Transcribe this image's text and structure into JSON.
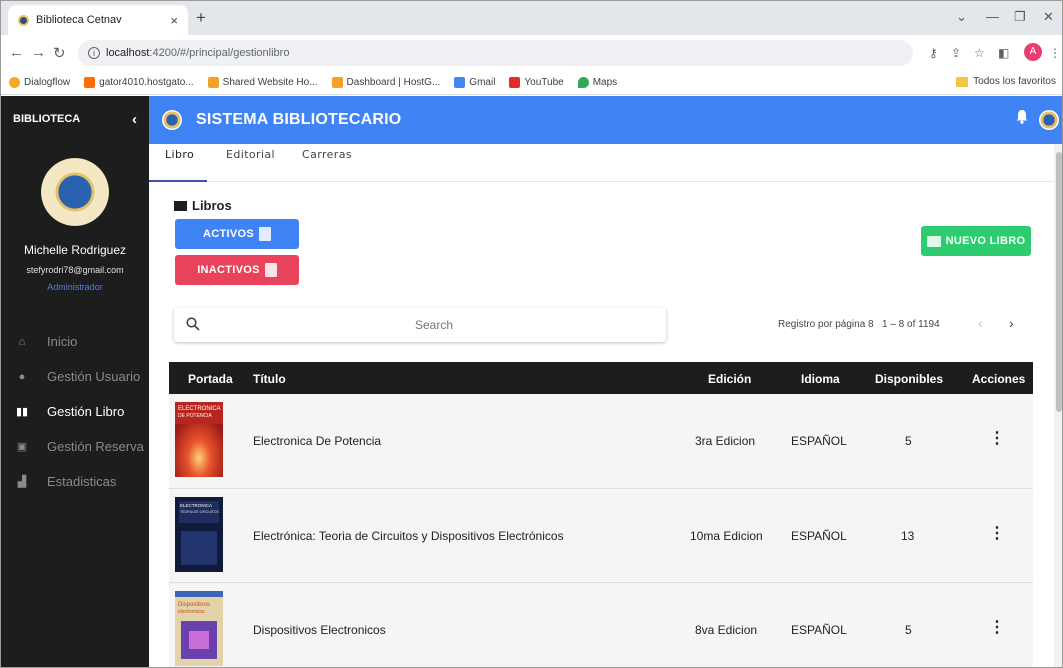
{
  "browser": {
    "tab_title": "Biblioteca Cetnav",
    "new_tab": "+",
    "url_host": "localhost",
    "url_path": ":4200/#/principal/gestionlibro",
    "bookmarks": [
      {
        "label": "Dialogflow",
        "color": "#f9a825"
      },
      {
        "label": "gator4010.hostgato...",
        "color": "#ff6d00"
      },
      {
        "label": "Shared Website Ho...",
        "color": "#f4a12b"
      },
      {
        "label": "Dashboard | HostG...",
        "color": "#f4a12b"
      },
      {
        "label": "Gmail",
        "color": "#4285f4"
      },
      {
        "label": "YouTube",
        "color": "#e52d27"
      },
      {
        "label": "Maps",
        "color": "#34a853"
      }
    ],
    "favorites_label": "Todos los favoritos",
    "profile_initial": "A"
  },
  "sidebar": {
    "title": "BIBLIOTECA",
    "user_name": "Michelle Rodriguez",
    "user_email": "stefyrodri78@gmail.com",
    "user_role": "Administrador",
    "items": [
      {
        "label": "Inicio",
        "icon": "home-icon"
      },
      {
        "label": "Gestión Usuario",
        "icon": "user-icon"
      },
      {
        "label": "Gestión Libro",
        "icon": "book-icon"
      },
      {
        "label": "Gestión Reserva",
        "icon": "reserve-icon"
      },
      {
        "label": "Estadisticas",
        "icon": "stats-icon"
      }
    ],
    "active_index": 2
  },
  "appbar": {
    "title": "SISTEMA BIBLIOTECARIO"
  },
  "tabs": [
    "Libro",
    "Editorial",
    "Carreras"
  ],
  "section": {
    "title": "Libros",
    "activos_label": "ACTIVOS",
    "inactivos_label": "INACTIVOS",
    "nuevo_label": "NUEVO LIBRO"
  },
  "search": {
    "placeholder": "Search",
    "value": ""
  },
  "paginator": {
    "label": "Registro por página 8",
    "range": "1 – 8 of 1194"
  },
  "table": {
    "columns": [
      "Portada",
      "Título",
      "Edición",
      "Idioma",
      "Disponibles",
      "Acciones"
    ],
    "rows": [
      {
        "titulo": "Electronica De Potencia",
        "edicion": "3ra Edicion",
        "idioma": "ESPAÑOL",
        "disponibles": "5",
        "cover_text": "ELECTRONICA DE POTENCIA"
      },
      {
        "titulo": "Electrónica: Teoria de Circuitos y Dispositivos Electrónicos",
        "edicion": "10ma Edicion",
        "idioma": "ESPAÑOL",
        "disponibles": "13",
        "cover_text": "ELECTRONICA TEORIA DE CIRCUITOS"
      },
      {
        "titulo": "Dispositivos Electronicos",
        "edicion": "8va Edicion",
        "idioma": "ESPAÑOL",
        "disponibles": "5",
        "cover_text": "Dispositivos electronicos"
      }
    ]
  },
  "colors": {
    "primary": "#3f83f5",
    "danger": "#e8435a",
    "success": "#2ecc71",
    "sidebar_bg": "#1d1d1d",
    "role": "#5a7be0"
  }
}
